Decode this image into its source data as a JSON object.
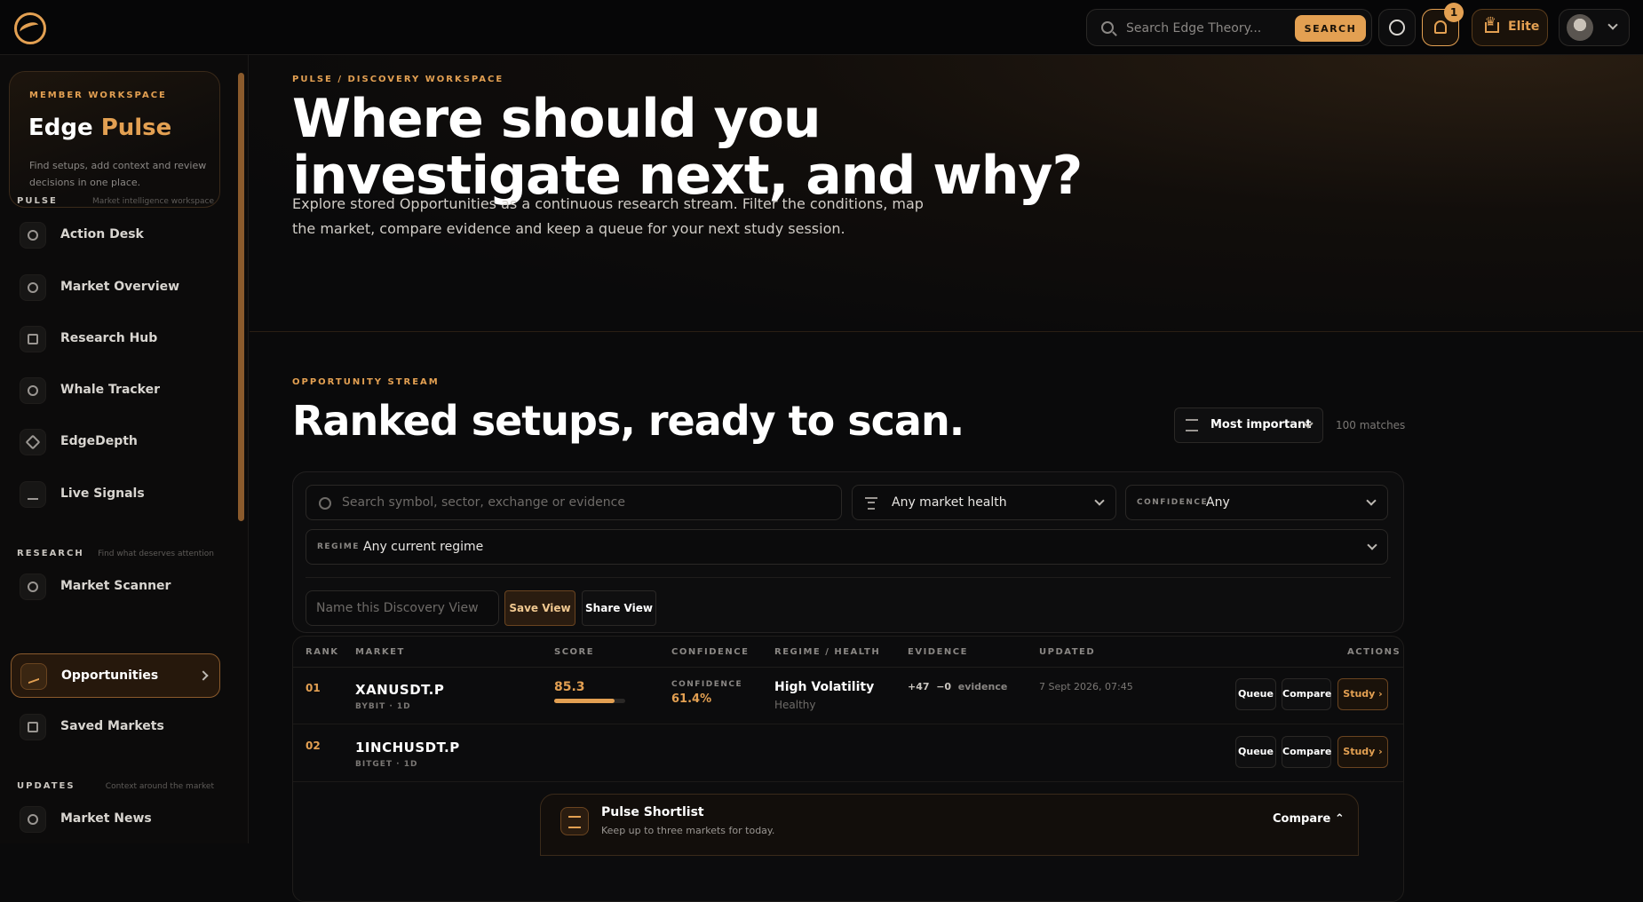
{
  "topbar": {
    "search_placeholder": "Search Edge Theory...",
    "search_button": "SEARCH",
    "notification_count": "1",
    "tier_label": "Elite"
  },
  "sidebar": {
    "workspace": {
      "kicker": "MEMBER WORKSPACE",
      "title_main": "Edge",
      "title_accent": "Pulse",
      "description": "Find setups, add context and review decisions in one place."
    },
    "sections": [
      {
        "label": "PULSE",
        "subtitle": "Market intelligence workspace"
      },
      {
        "label": "RESEARCH",
        "subtitle": "Find what deserves attention"
      },
      {
        "label": "UPDATES",
        "subtitle": "Context around the market"
      }
    ],
    "items": [
      {
        "label": "Action Desk",
        "icon": "compass-icon"
      },
      {
        "label": "Market Overview",
        "icon": "compass-icon"
      },
      {
        "label": "Research Hub",
        "icon": "book-icon"
      },
      {
        "label": "Whale Tracker",
        "icon": "whale-icon"
      },
      {
        "label": "EdgeDepth",
        "icon": "layers-icon"
      },
      {
        "label": "Live Signals",
        "icon": "pulse-icon"
      },
      {
        "label": "Market Scanner",
        "icon": "search-icon"
      },
      {
        "label": "Opportunities",
        "icon": "pulse-icon",
        "active": true
      },
      {
        "label": "Saved Markets",
        "icon": "calendar-icon"
      },
      {
        "label": "Market News",
        "icon": "broadcast-icon"
      }
    ]
  },
  "hero": {
    "breadcrumb": "PULSE / DISCOVERY WORKSPACE",
    "title": "Where should you investigate next, and why?",
    "lead": "Explore stored Opportunities as a continuous research stream. Filter the conditions, map the market, compare evidence and keep a queue for your next study session."
  },
  "stream": {
    "kicker": "OPPORTUNITY STREAM",
    "title": "Ranked setups, ready to scan.",
    "sort_label": "Most important",
    "matches": "100 matches"
  },
  "filters": {
    "search_placeholder": "Search symbol, sector, exchange or evidence",
    "market_health": "Any market health",
    "confidence_tag": "CONFIDENCE",
    "confidence_value": "Any",
    "regime_tag": "REGIME",
    "regime_value": "Any current regime",
    "view_name_placeholder": "Name this Discovery View",
    "save_view": "Save View",
    "share_view": "Share View"
  },
  "table": {
    "columns": [
      "RANK",
      "MARKET",
      "SCORE",
      "CONFIDENCE",
      "REGIME / HEALTH",
      "EVIDENCE",
      "UPDATED",
      "ACTIONS"
    ],
    "rows": [
      {
        "rank": "01",
        "symbol": "XANUSDT.P",
        "exchange": "BYBIT · 1D",
        "score": "85.3",
        "score_fraction": 0.853,
        "confidence_tag": "CONFIDENCE",
        "confidence": "61.4%",
        "regime": "High Volatility",
        "health": "Healthy",
        "evidence_plus": "+47",
        "evidence_minus": "−0",
        "evidence_label": "evidence",
        "updated": "7 Sept 2026, 07:45",
        "actions": [
          "Queue",
          "Compare",
          "Study ›"
        ]
      },
      {
        "rank": "02",
        "symbol": "1INCHUSDT.P",
        "exchange": "BITGET · 1D",
        "actions": [
          "Queue",
          "Compare",
          "Study ›"
        ]
      }
    ]
  },
  "shortlist": {
    "title": "Pulse Shortlist",
    "subtitle": "Keep up to three markets for today.",
    "compare": "Compare ⌃"
  },
  "colors": {
    "accent": "#e3a052",
    "background": "#0a0a0b"
  }
}
